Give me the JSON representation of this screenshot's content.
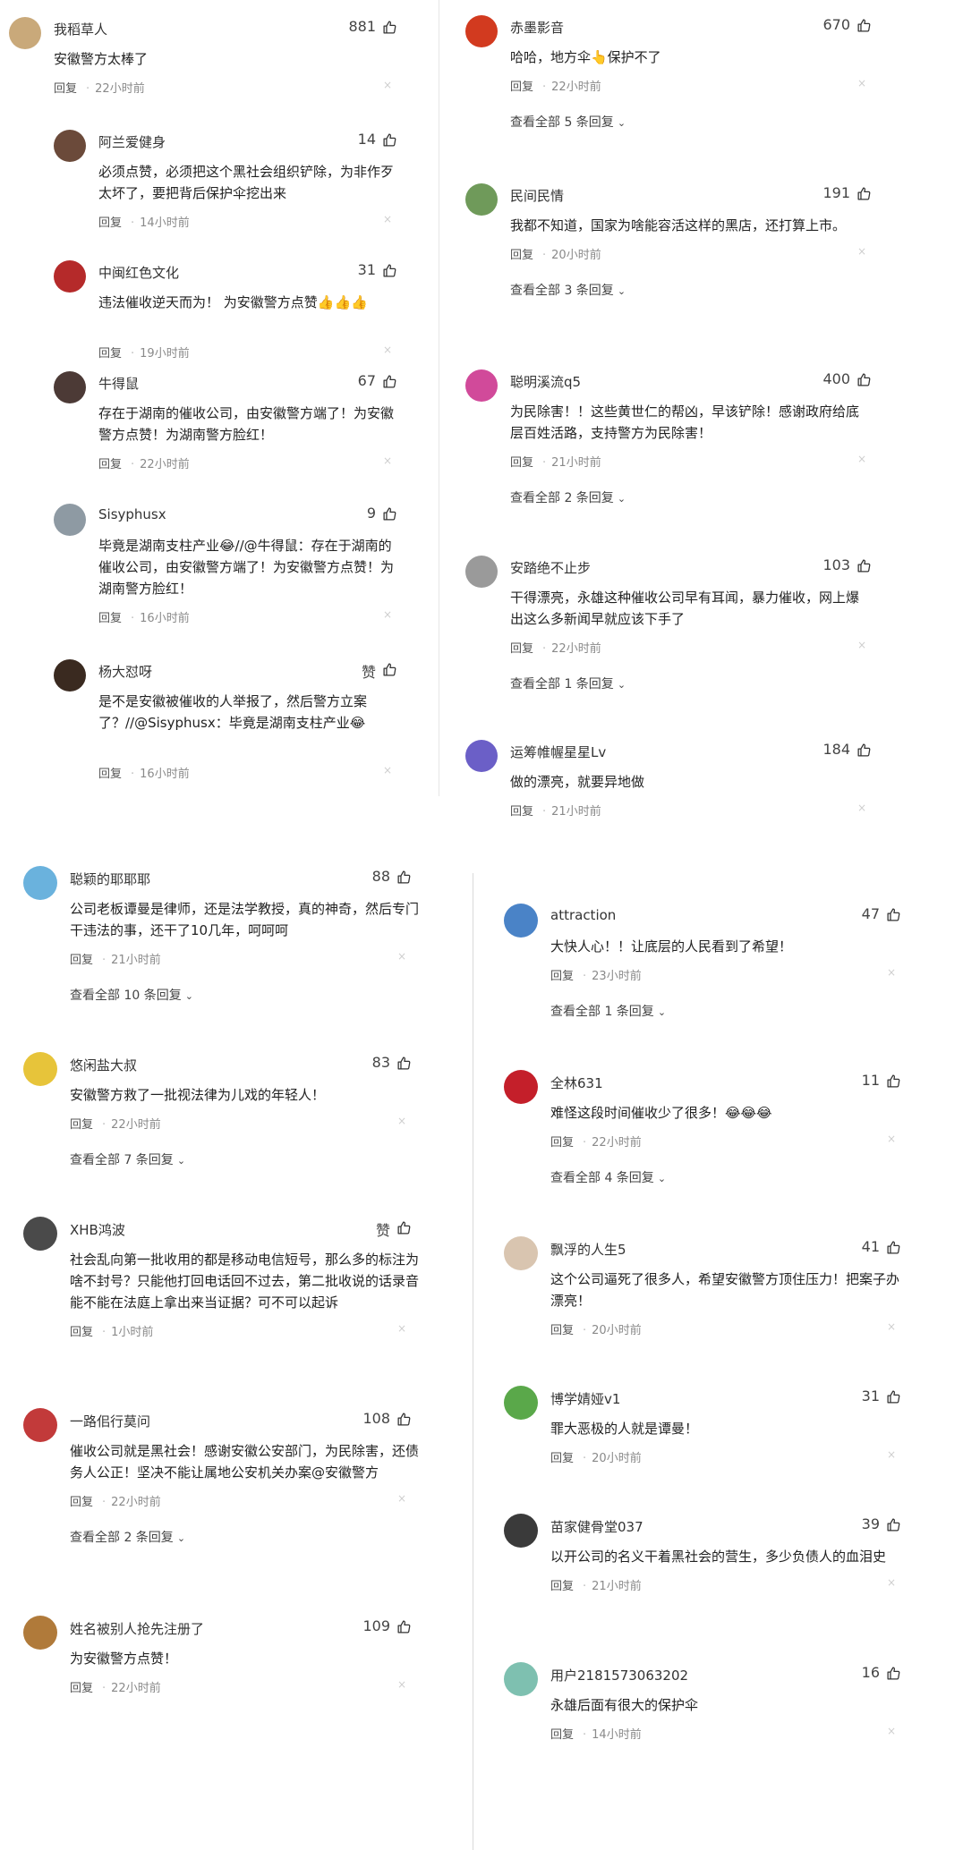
{
  "ui": {
    "reply": "回复",
    "dot": "·",
    "close": "×"
  },
  "panel1": {
    "c1": {
      "name": "我稻草人",
      "likes": "881",
      "text": "安徽警方太棒了",
      "time": "22小时前"
    },
    "r1": {
      "name": "阿兰爱健身",
      "likes": "14",
      "text": "必须点赞，必须把这个黑社会组织铲除，为非作歹太坏了，要把背后保护伞挖出来",
      "time": "14小时前"
    },
    "r2": {
      "name": "中闽红色文化",
      "likes": "31",
      "text": "违法催收逆天而为！ 为安徽警方点赞👍👍👍",
      "time": "19小时前"
    },
    "r3": {
      "name": "牛得鼠",
      "likes": "67",
      "text": "存在于湖南的催收公司，由安徽警方端了！为安徽警方点赞！为湖南警方脸红！",
      "time": "22小时前"
    },
    "r4": {
      "name": "Sisyphusx",
      "likes": "9",
      "text": "毕竟是湖南支柱产业😂//@牛得鼠：存在于湖南的催收公司，由安徽警方端了！为安徽警方点赞！为湖南警方脸红！",
      "time": "16小时前"
    },
    "r5": {
      "name": "杨大怼呀",
      "likes": "赞",
      "text": "是不是安徽被催收的人举报了，然后警方立案了？//@Sisyphusx：毕竟是湖南支柱产业😂",
      "time": "16小时前"
    }
  },
  "panel2": {
    "c1": {
      "name": "赤墨影音",
      "likes": "670",
      "text": "哈哈，地方伞👆保护不了",
      "time": "22小时前",
      "more": "查看全部 5 条回复"
    },
    "c2": {
      "name": "民间民情",
      "likes": "191",
      "text": "我都不知道，国家为啥能容活这样的黑店，还打算上市。",
      "time": "20小时前",
      "more": "查看全部 3 条回复"
    },
    "c3": {
      "name": "聪明溪流q5",
      "likes": "400",
      "text": "为民除害！！这些黄世仁的帮凶，早该铲除！感谢政府给底层百姓活路，支持警方为民除害！",
      "time": "21小时前",
      "more": "查看全部 2 条回复"
    },
    "c4": {
      "name": "安踏绝不止步",
      "likes": "103",
      "text": "干得漂亮，永雄这种催收公司早有耳闻，暴力催收，网上爆出这么多新闻早就应该下手了",
      "time": "22小时前",
      "more": "查看全部 1 条回复"
    },
    "c5": {
      "name": "运筹帷幄星星Lv",
      "likes": "184",
      "text": "做的漂亮，就要异地做",
      "time": "21小时前"
    }
  },
  "panel3": {
    "c1": {
      "name": "聪颖的耶耶耶",
      "likes": "88",
      "text": "公司老板谭曼是律师，还是法学教授，真的神奇，然后专门干违法的事，还干了10几年，呵呵呵",
      "time": "21小时前",
      "more": "查看全部 10 条回复"
    },
    "c2": {
      "name": "悠闲盐大叔",
      "likes": "83",
      "text": "安徽警方救了一批视法律为儿戏的年轻人！",
      "time": "22小时前",
      "more": "查看全部 7 条回复"
    },
    "c3": {
      "name": "XHB鸿波",
      "likes": "赞",
      "text": "社会乱向第一批收用的都是移动电信短号，那么多的标注为啥不封号？只能他打回电话回不过去，第二批收说的话录音能不能在法庭上拿出来当证据？可不可以起诉",
      "time": "1小时前"
    },
    "c4": {
      "name": "一路佀行莫问",
      "likes": "108",
      "text": "催收公司就是黑社会！感谢安徽公安部门，为民除害，还债务人公正！坚决不能让属地公安机关办案@安徽警方",
      "time": "22小时前",
      "more": "查看全部 2 条回复"
    },
    "c5": {
      "name": "姓名被别人抢先注册了",
      "likes": "109",
      "text": "为安徽警方点赞！",
      "time": "22小时前"
    }
  },
  "panel4": {
    "c1": {
      "name": "attraction",
      "likes": "47",
      "text": "大快人心！！让底层的人民看到了希望！",
      "time": "23小时前",
      "more": "查看全部 1 条回复"
    },
    "c2": {
      "name": "全林631",
      "likes": "11",
      "text": "难怪这段时间催收少了很多！😂😂😂",
      "time": "22小时前",
      "more": "查看全部 4 条回复"
    },
    "c3": {
      "name": "飘浮的人生5",
      "likes": "41",
      "text": "这个公司逼死了很多人，希望安徽警方顶住压力！把案子办漂亮！",
      "time": "20小时前"
    },
    "c4": {
      "name": "博学婧娅v1",
      "likes": "31",
      "text": "罪大恶极的人就是谭曼！",
      "time": "20小时前"
    },
    "c5": {
      "name": "苗家健骨堂037",
      "likes": "39",
      "text": "以开公司的名义干着黑社会的营生，多少负债人的血泪史",
      "time": "21小时前"
    },
    "c6": {
      "name": "用户2181573063202",
      "likes": "16",
      "text": "永雄后面有很大的保护伞",
      "time": "14小时前"
    }
  },
  "colors": {
    "meta": "#8a8a8a",
    "text": "#222222",
    "divider": "#e6e6e6"
  },
  "icons": {
    "like": "thumbs-up-icon",
    "close": "close-icon",
    "chevron": "chevron-down-icon"
  }
}
